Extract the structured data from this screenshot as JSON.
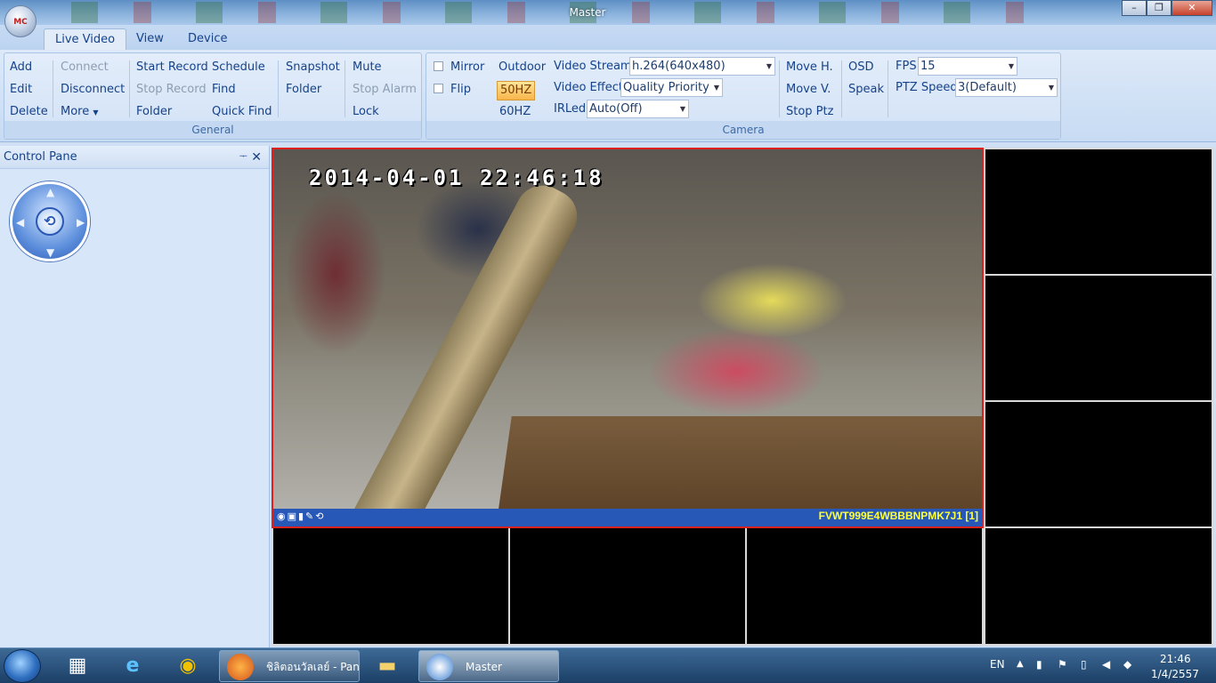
{
  "window": {
    "title": "Master",
    "orb_label": "MC",
    "minimize": "–",
    "maximize": "❐",
    "close": "✕"
  },
  "tabs": [
    "Live Video",
    "View",
    "Device"
  ],
  "general": {
    "label": "General",
    "add": "Add",
    "edit": "Edit",
    "delete": "Delete",
    "connect": "Connect",
    "disconnect": "Disconnect",
    "more": "More",
    "start_record": "Start Record",
    "stop_record": "Stop Record",
    "folder1": "Folder",
    "schedule": "Schedule",
    "find": "Find",
    "quick_find": "Quick Find",
    "snapshot": "Snapshot",
    "folder2": "Folder",
    "mute": "Mute",
    "stop_alarm": "Stop Alarm",
    "lock": "Lock"
  },
  "camera": {
    "label": "Camera",
    "mirror": "Mirror",
    "flip": "Flip",
    "outdoor": "Outdoor",
    "hz50": "50HZ",
    "hz60": "60HZ",
    "video_stream_label": "Video Stream",
    "video_stream_value": "h.264(640x480)",
    "video_effect_label": "Video Effect",
    "video_effect_value": "Quality Priority",
    "irled_label": "IRLed",
    "irled_value": "Auto(Off)",
    "move_h": "Move H.",
    "move_v": "Move V.",
    "stop_ptz": "Stop Ptz",
    "osd": "OSD",
    "speak": "Speak",
    "fps_label": "FPS",
    "fps_value": "15",
    "ptz_speed_label": "PTZ Speed",
    "ptz_speed_value": "3(Default)"
  },
  "control_pane": {
    "title": "Control Pane",
    "pin": "ᅮ",
    "close": "✕"
  },
  "video": {
    "timestamp": "2014-04-01  22:46:18",
    "camera_id": "FVWT999E4WBBBNPMK7J1 [1]",
    "toolbar_icons": "◉▣▮✎⟲"
  },
  "taskbar": {
    "firefox_label": "ชิลิตอนวัลเลย์ - Pan...",
    "master_label": "Master",
    "lang": "EN",
    "time": "21:46",
    "date": "1/4/2557"
  }
}
